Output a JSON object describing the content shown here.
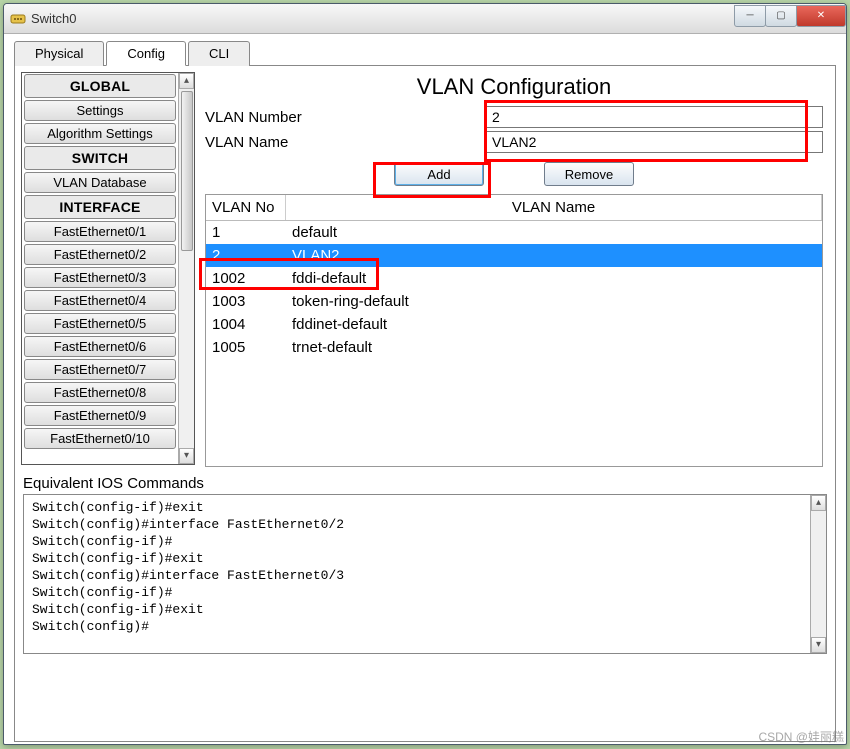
{
  "window": {
    "title": "Switch0"
  },
  "tabs": [
    {
      "label": "Physical",
      "active": false
    },
    {
      "label": "Config",
      "active": true
    },
    {
      "label": "CLI",
      "active": false
    }
  ],
  "sidebar": {
    "groups": [
      {
        "label": "GLOBAL",
        "items": [
          "Settings",
          "Algorithm Settings"
        ]
      },
      {
        "label": "SWITCH",
        "items": [
          "VLAN Database"
        ]
      },
      {
        "label": "INTERFACE",
        "items": [
          "FastEthernet0/1",
          "FastEthernet0/2",
          "FastEthernet0/3",
          "FastEthernet0/4",
          "FastEthernet0/5",
          "FastEthernet0/6",
          "FastEthernet0/7",
          "FastEthernet0/8",
          "FastEthernet0/9",
          "FastEthernet0/10"
        ]
      }
    ]
  },
  "vlan_panel": {
    "title": "VLAN Configuration",
    "number_label": "VLAN Number",
    "number_value": "2",
    "name_label": "VLAN Name",
    "name_value": "VLAN2",
    "add_label": "Add",
    "remove_label": "Remove",
    "col_no": "VLAN No",
    "col_name": "VLAN Name",
    "rows": [
      {
        "no": "1",
        "name": "default",
        "selected": false
      },
      {
        "no": "2",
        "name": "VLAN2",
        "selected": true
      },
      {
        "no": "1002",
        "name": "fddi-default",
        "selected": false
      },
      {
        "no": "1003",
        "name": "token-ring-default",
        "selected": false
      },
      {
        "no": "1004",
        "name": "fddinet-default",
        "selected": false
      },
      {
        "no": "1005",
        "name": "trnet-default",
        "selected": false
      }
    ]
  },
  "ios": {
    "label": "Equivalent IOS Commands",
    "lines": [
      "Switch(config-if)#exit",
      "Switch(config)#interface FastEthernet0/2",
      "Switch(config-if)#",
      "Switch(config-if)#exit",
      "Switch(config)#interface FastEthernet0/3",
      "Switch(config-if)#",
      "Switch(config-if)#exit",
      "Switch(config)#"
    ]
  },
  "watermark": "CSDN @娃丽糕"
}
